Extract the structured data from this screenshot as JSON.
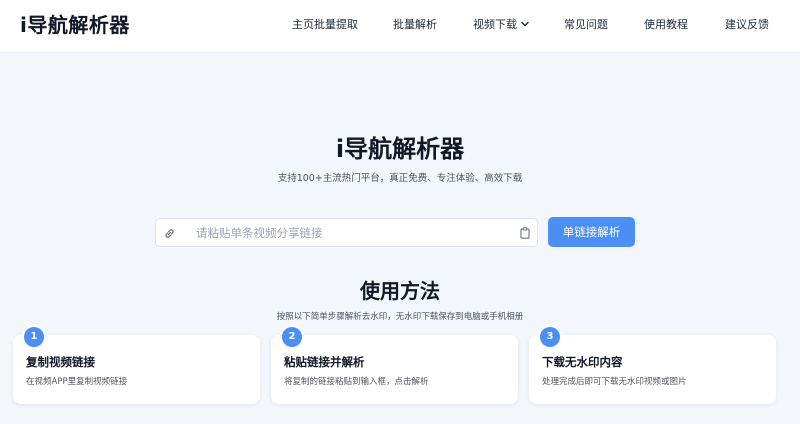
{
  "header": {
    "logo": "i导航解析器",
    "nav": [
      {
        "label": "主页批量提取"
      },
      {
        "label": "批量解析"
      },
      {
        "label": "视频下载"
      },
      {
        "label": "常见问题"
      },
      {
        "label": "使用教程"
      },
      {
        "label": "建议反馈"
      }
    ]
  },
  "hero": {
    "title": "i导航解析器",
    "subtitle": "支持100+主流热门平台，真正免费、专注体验、高效下载",
    "search": {
      "placeholder": "请粘贴单条视频分享链接",
      "value": ""
    },
    "parse_button": "单链接解析"
  },
  "usage": {
    "title": "使用方法",
    "subtitle": "按照以下简单步骤解析去水印，无水印下载保存到电脑或手机相册",
    "steps": [
      {
        "number": "1",
        "title": "复制视频链接",
        "desc": "在视频APP里复制视频链接"
      },
      {
        "number": "2",
        "title": "粘贴链接并解析",
        "desc": "将复制的链接粘贴到输入框，点击解析"
      },
      {
        "number": "3",
        "title": "下载无水印内容",
        "desc": "处理完成后即可下载无水印视频或图片"
      }
    ]
  },
  "colors": {
    "accent": "#4b8ff5",
    "page_background": "#f3f6fb",
    "header_background": "#ffffff"
  },
  "icons": {
    "nav_dropdown": "chevron-down-icon",
    "search_left": "link-icon",
    "search_right": "clipboard-icon"
  }
}
